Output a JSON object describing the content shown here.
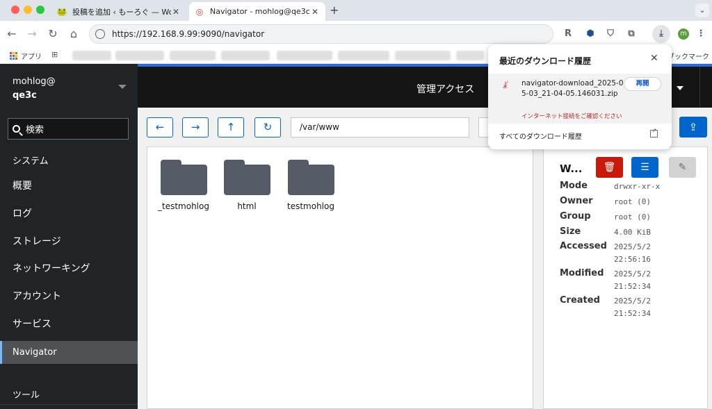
{
  "browser": {
    "tabs": [
      {
        "title": "投稿を追加 ‹ もーろぐ — WordP",
        "active": false
      },
      {
        "title": "Navigator - mohlog@qe3c",
        "active": true
      }
    ],
    "url": "https://192.168.9.99:9090/navigator",
    "bookmarks": {
      "apps_label": "アプリ",
      "end_label": "ブックマーク"
    },
    "profile_initial": "m",
    "colors": {
      "tab_bar": "#dfe3ea",
      "omnibox": "#f1f3f4"
    }
  },
  "download_popup": {
    "title": "最近のダウンロード履歴",
    "item": {
      "filename": "navigator-download_2025-05-03_21-04-05.146031.zip",
      "error": "インターネット接続をご確認ください",
      "resume_label": "再開"
    },
    "all_history_label": "すべてのダウンロード履歴"
  },
  "sidebar": {
    "host_user": "mohlog@",
    "host_name": "qe3c",
    "search_label": "検索",
    "section_system": "システム",
    "items": [
      {
        "label": "概要",
        "selected": false
      },
      {
        "label": "ログ",
        "selected": false
      },
      {
        "label": "ストレージ",
        "selected": false
      },
      {
        "label": "ネットワーキング",
        "selected": false
      },
      {
        "label": "アカウント",
        "selected": false
      },
      {
        "label": "サービス",
        "selected": false
      },
      {
        "label": "Navigator",
        "selected": true
      }
    ],
    "section_tools": "ツール"
  },
  "topbar": {
    "admin_label": "管理アクセス"
  },
  "navigator": {
    "path": "/var/www",
    "folders": [
      "_testmohlog",
      "html",
      "testmohlog"
    ],
    "details": {
      "title": "W...",
      "rows": [
        {
          "key": "Mode",
          "value": [
            "drwxr-xr-x"
          ]
        },
        {
          "key": "Owner",
          "value": [
            "root (0)"
          ]
        },
        {
          "key": "Group",
          "value": [
            "root (0)"
          ]
        },
        {
          "key": "Size",
          "value": [
            "4.00 KiB"
          ]
        },
        {
          "key": "Accessed",
          "value": [
            "2025/5/2",
            "22:56:16"
          ]
        },
        {
          "key": "Modified",
          "value": [
            "2025/5/2",
            "21:52:34"
          ]
        },
        {
          "key": "Created",
          "value": [
            "2025/5/2",
            "21:52:34"
          ]
        }
      ]
    },
    "colors": {
      "primary": "#0066cc",
      "danger": "#c9190b",
      "disabled": "#d2d2d2",
      "folder": "#545a66"
    }
  }
}
